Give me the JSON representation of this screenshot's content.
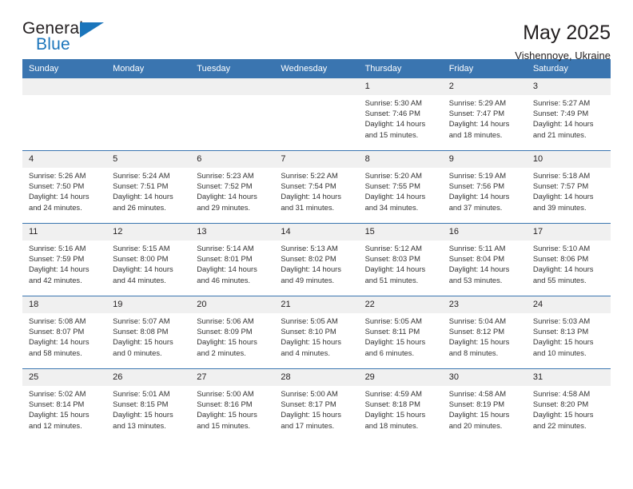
{
  "logo": {
    "word1": "General",
    "word2": "Blue",
    "triangle_color": "#1b75bb"
  },
  "header": {
    "title": "May 2025",
    "subtitle": "Vishennoye, Ukraine"
  },
  "theme": {
    "header_blue": "#3a75b0",
    "cell_band": "#f0f0f0",
    "text": "#231f20"
  },
  "calendar": {
    "weekday_headers": [
      "Sunday",
      "Monday",
      "Tuesday",
      "Wednesday",
      "Thursday",
      "Friday",
      "Saturday"
    ],
    "weeks": [
      [
        {
          "empty": true
        },
        {
          "empty": true
        },
        {
          "empty": true
        },
        {
          "empty": true
        },
        {
          "day": "1",
          "sunrise": "Sunrise: 5:30 AM",
          "sunset": "Sunset: 7:46 PM",
          "daylight1": "Daylight: 14 hours",
          "daylight2": "and 15 minutes."
        },
        {
          "day": "2",
          "sunrise": "Sunrise: 5:29 AM",
          "sunset": "Sunset: 7:47 PM",
          "daylight1": "Daylight: 14 hours",
          "daylight2": "and 18 minutes."
        },
        {
          "day": "3",
          "sunrise": "Sunrise: 5:27 AM",
          "sunset": "Sunset: 7:49 PM",
          "daylight1": "Daylight: 14 hours",
          "daylight2": "and 21 minutes."
        }
      ],
      [
        {
          "day": "4",
          "sunrise": "Sunrise: 5:26 AM",
          "sunset": "Sunset: 7:50 PM",
          "daylight1": "Daylight: 14 hours",
          "daylight2": "and 24 minutes."
        },
        {
          "day": "5",
          "sunrise": "Sunrise: 5:24 AM",
          "sunset": "Sunset: 7:51 PM",
          "daylight1": "Daylight: 14 hours",
          "daylight2": "and 26 minutes."
        },
        {
          "day": "6",
          "sunrise": "Sunrise: 5:23 AM",
          "sunset": "Sunset: 7:52 PM",
          "daylight1": "Daylight: 14 hours",
          "daylight2": "and 29 minutes."
        },
        {
          "day": "7",
          "sunrise": "Sunrise: 5:22 AM",
          "sunset": "Sunset: 7:54 PM",
          "daylight1": "Daylight: 14 hours",
          "daylight2": "and 31 minutes."
        },
        {
          "day": "8",
          "sunrise": "Sunrise: 5:20 AM",
          "sunset": "Sunset: 7:55 PM",
          "daylight1": "Daylight: 14 hours",
          "daylight2": "and 34 minutes."
        },
        {
          "day": "9",
          "sunrise": "Sunrise: 5:19 AM",
          "sunset": "Sunset: 7:56 PM",
          "daylight1": "Daylight: 14 hours",
          "daylight2": "and 37 minutes."
        },
        {
          "day": "10",
          "sunrise": "Sunrise: 5:18 AM",
          "sunset": "Sunset: 7:57 PM",
          "daylight1": "Daylight: 14 hours",
          "daylight2": "and 39 minutes."
        }
      ],
      [
        {
          "day": "11",
          "sunrise": "Sunrise: 5:16 AM",
          "sunset": "Sunset: 7:59 PM",
          "daylight1": "Daylight: 14 hours",
          "daylight2": "and 42 minutes."
        },
        {
          "day": "12",
          "sunrise": "Sunrise: 5:15 AM",
          "sunset": "Sunset: 8:00 PM",
          "daylight1": "Daylight: 14 hours",
          "daylight2": "and 44 minutes."
        },
        {
          "day": "13",
          "sunrise": "Sunrise: 5:14 AM",
          "sunset": "Sunset: 8:01 PM",
          "daylight1": "Daylight: 14 hours",
          "daylight2": "and 46 minutes."
        },
        {
          "day": "14",
          "sunrise": "Sunrise: 5:13 AM",
          "sunset": "Sunset: 8:02 PM",
          "daylight1": "Daylight: 14 hours",
          "daylight2": "and 49 minutes."
        },
        {
          "day": "15",
          "sunrise": "Sunrise: 5:12 AM",
          "sunset": "Sunset: 8:03 PM",
          "daylight1": "Daylight: 14 hours",
          "daylight2": "and 51 minutes."
        },
        {
          "day": "16",
          "sunrise": "Sunrise: 5:11 AM",
          "sunset": "Sunset: 8:04 PM",
          "daylight1": "Daylight: 14 hours",
          "daylight2": "and 53 minutes."
        },
        {
          "day": "17",
          "sunrise": "Sunrise: 5:10 AM",
          "sunset": "Sunset: 8:06 PM",
          "daylight1": "Daylight: 14 hours",
          "daylight2": "and 55 minutes."
        }
      ],
      [
        {
          "day": "18",
          "sunrise": "Sunrise: 5:08 AM",
          "sunset": "Sunset: 8:07 PM",
          "daylight1": "Daylight: 14 hours",
          "daylight2": "and 58 minutes."
        },
        {
          "day": "19",
          "sunrise": "Sunrise: 5:07 AM",
          "sunset": "Sunset: 8:08 PM",
          "daylight1": "Daylight: 15 hours",
          "daylight2": "and 0 minutes."
        },
        {
          "day": "20",
          "sunrise": "Sunrise: 5:06 AM",
          "sunset": "Sunset: 8:09 PM",
          "daylight1": "Daylight: 15 hours",
          "daylight2": "and 2 minutes."
        },
        {
          "day": "21",
          "sunrise": "Sunrise: 5:05 AM",
          "sunset": "Sunset: 8:10 PM",
          "daylight1": "Daylight: 15 hours",
          "daylight2": "and 4 minutes."
        },
        {
          "day": "22",
          "sunrise": "Sunrise: 5:05 AM",
          "sunset": "Sunset: 8:11 PM",
          "daylight1": "Daylight: 15 hours",
          "daylight2": "and 6 minutes."
        },
        {
          "day": "23",
          "sunrise": "Sunrise: 5:04 AM",
          "sunset": "Sunset: 8:12 PM",
          "daylight1": "Daylight: 15 hours",
          "daylight2": "and 8 minutes."
        },
        {
          "day": "24",
          "sunrise": "Sunrise: 5:03 AM",
          "sunset": "Sunset: 8:13 PM",
          "daylight1": "Daylight: 15 hours",
          "daylight2": "and 10 minutes."
        }
      ],
      [
        {
          "day": "25",
          "sunrise": "Sunrise: 5:02 AM",
          "sunset": "Sunset: 8:14 PM",
          "daylight1": "Daylight: 15 hours",
          "daylight2": "and 12 minutes."
        },
        {
          "day": "26",
          "sunrise": "Sunrise: 5:01 AM",
          "sunset": "Sunset: 8:15 PM",
          "daylight1": "Daylight: 15 hours",
          "daylight2": "and 13 minutes."
        },
        {
          "day": "27",
          "sunrise": "Sunrise: 5:00 AM",
          "sunset": "Sunset: 8:16 PM",
          "daylight1": "Daylight: 15 hours",
          "daylight2": "and 15 minutes."
        },
        {
          "day": "28",
          "sunrise": "Sunrise: 5:00 AM",
          "sunset": "Sunset: 8:17 PM",
          "daylight1": "Daylight: 15 hours",
          "daylight2": "and 17 minutes."
        },
        {
          "day": "29",
          "sunrise": "Sunrise: 4:59 AM",
          "sunset": "Sunset: 8:18 PM",
          "daylight1": "Daylight: 15 hours",
          "daylight2": "and 18 minutes."
        },
        {
          "day": "30",
          "sunrise": "Sunrise: 4:58 AM",
          "sunset": "Sunset: 8:19 PM",
          "daylight1": "Daylight: 15 hours",
          "daylight2": "and 20 minutes."
        },
        {
          "day": "31",
          "sunrise": "Sunrise: 4:58 AM",
          "sunset": "Sunset: 8:20 PM",
          "daylight1": "Daylight: 15 hours",
          "daylight2": "and 22 minutes."
        }
      ]
    ]
  }
}
